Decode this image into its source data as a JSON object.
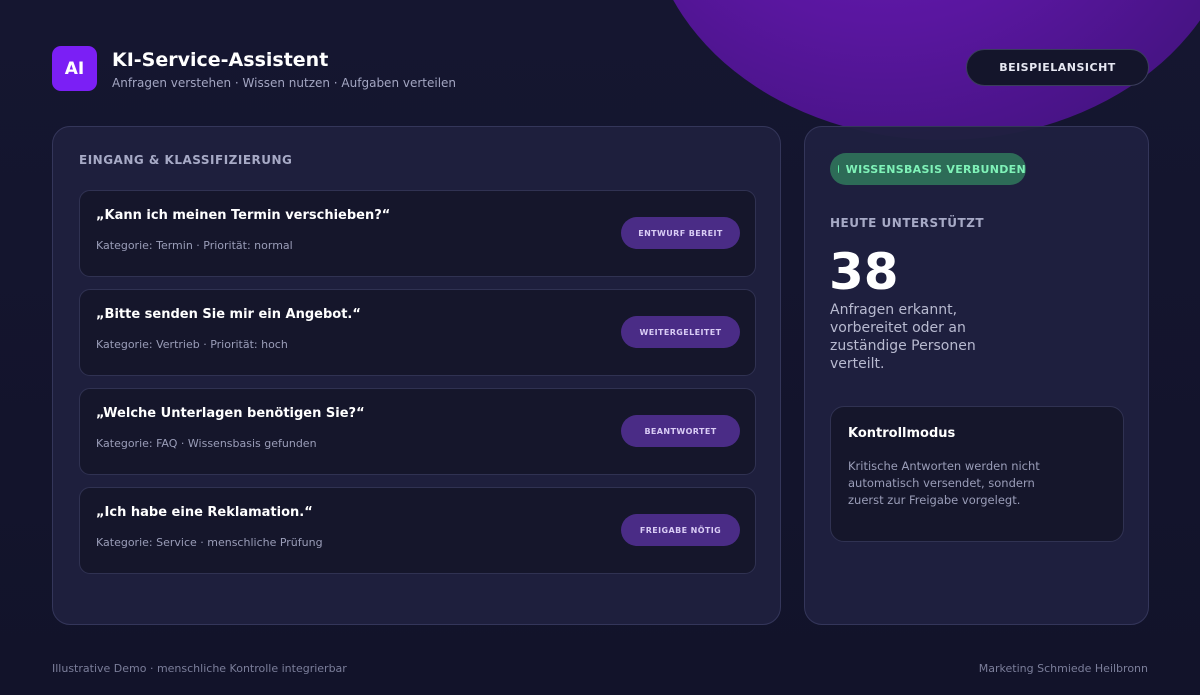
{
  "header": {
    "logo_text": "AI",
    "title": "KI-Service-Assistent",
    "subtitle": "Anfragen verstehen · Wissen nutzen · Aufgaben verteilen",
    "demo_button": "BEISPIELANSICHT"
  },
  "intake": {
    "title": "EINGANG & KLASSIFIZIERUNG",
    "items": [
      {
        "question": "„Kann ich meinen Termin verschieben?“",
        "meta": "Kategorie: Termin · Priorität: normal",
        "status": "ENTWURF BEREIT"
      },
      {
        "question": "„Bitte senden Sie mir ein Angebot.“",
        "meta": "Kategorie: Vertrieb · Priorität: hoch",
        "status": "WEITERGELEITET"
      },
      {
        "question": "„Welche Unterlagen benötigen Sie?“",
        "meta": "Kategorie: FAQ · Wissensbasis gefunden",
        "status": "BEANTWORTET"
      },
      {
        "question": "„Ich habe eine Reklamation.“",
        "meta": "Kategorie: Service · menschliche Prüfung",
        "status": "FREIGABE NÖTIG"
      }
    ]
  },
  "stats": {
    "kb_status": "WISSENSBASIS VERBUNDEN",
    "today_label": "HEUTE UNTERSTÜTZT",
    "today_count": "38",
    "today_desc": "Anfragen erkannt, vorbereitet oder an zuständige Personen verteilt.",
    "control_title": "Kontrollmodus",
    "control_text": "Kritische Antworten werden nicht automatisch versendet, sondern zuerst zur Freigabe vorgelegt."
  },
  "footer": {
    "left": "Illustrative Demo · menschliche Kontrolle integrierbar",
    "right": "Marketing Schmiede Heilbronn"
  },
  "colors": {
    "accent": "#7b1ff5",
    "badge": "#4a2c86",
    "kb_green": "#2d6b57",
    "background": "#13132a"
  }
}
